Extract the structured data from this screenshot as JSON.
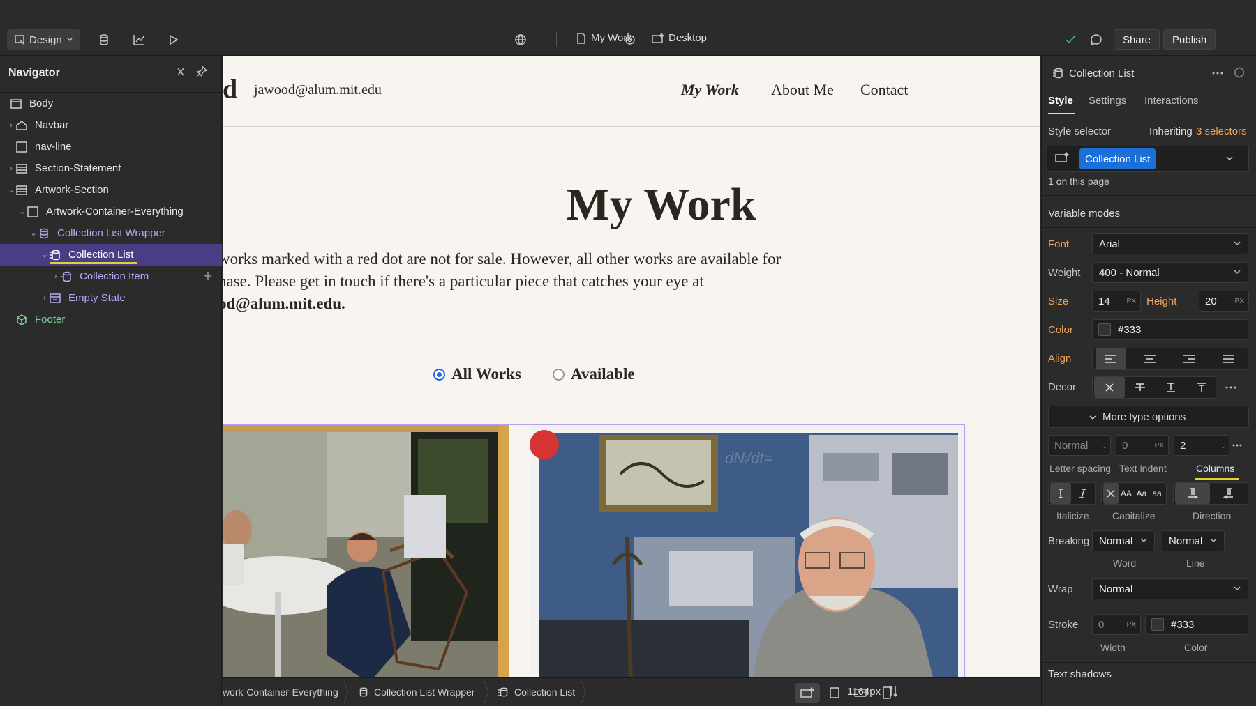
{
  "topbar": {
    "design_label": "Design",
    "page_name": "My Work",
    "breakpoint_label": "Desktop",
    "share_label": "Share",
    "publish_label": "Publish"
  },
  "navigator": {
    "title": "Navigator",
    "items": [
      {
        "label": "Body"
      },
      {
        "label": "Navbar"
      },
      {
        "label": "nav-line"
      },
      {
        "label": "Section-Statement"
      },
      {
        "label": "Artwork-Section"
      },
      {
        "label": "Artwork-Container-Everything"
      },
      {
        "label": "Collection List Wrapper"
      },
      {
        "label": "Collection List"
      },
      {
        "label": "Collection Item"
      },
      {
        "label": "Empty State"
      },
      {
        "label": "Footer"
      }
    ]
  },
  "site": {
    "logo_fragment": "d",
    "email": "jawood@alum.mit.edu",
    "nav": [
      "My Work",
      "About Me",
      "Contact"
    ],
    "title": "My Work",
    "para_line1": "works marked with a red dot are not for sale. However, all other works are available for",
    "para_line2": "hase. Please get in touch if there's a particular piece that catches your eye at",
    "para_line3": "od@alum.mit.edu.",
    "filter_all": "All Works",
    "filter_available": "Available"
  },
  "bottombar": {
    "crumbs": [
      "work-Container-Everything",
      "Collection List Wrapper",
      "Collection List"
    ],
    "width_label": "1164px"
  },
  "panel": {
    "element_title": "Collection List",
    "tabs": [
      "Style",
      "Settings",
      "Interactions"
    ],
    "style_selector_label": "Style selector",
    "inheriting_label": "Inheriting",
    "inheriting_count": "3 selectors",
    "selector_chip": "Collection List",
    "on_page": "1 on this page",
    "variable_modes": "Variable modes",
    "font_label": "Font",
    "font_value": "Arial",
    "weight_label": "Weight",
    "weight_value": "400 - Normal",
    "size_label": "Size",
    "size_value": "14",
    "size_unit": "PX",
    "height_label": "Height",
    "height_value": "20",
    "height_unit": "PX",
    "color_label": "Color",
    "color_value": "#333",
    "align_label": "Align",
    "decor_label": "Decor",
    "more_type": "More type options",
    "letter_spacing_value": "Normal",
    "letter_spacing_unit": "-",
    "text_indent_value": "0",
    "text_indent_unit": "PX",
    "columns_value": "2",
    "columns_unit": "-",
    "letter_spacing_label": "Letter spacing",
    "text_indent_label": "Text indent",
    "columns_label": "Columns",
    "italicize_label": "Italicize",
    "capitalize_label": "Capitalize",
    "direction_label": "Direction",
    "cap_aa1": "AA",
    "cap_aa2": "Aa",
    "cap_aa3": "aa",
    "breaking_label": "Breaking",
    "word_value": "Normal",
    "line_value": "Normal",
    "word_label": "Word",
    "line_label": "Line",
    "wrap_label": "Wrap",
    "wrap_value": "Normal",
    "stroke_label": "Stroke",
    "stroke_width": "0",
    "stroke_unit": "PX",
    "stroke_color": "#333",
    "width_label": "Width",
    "stroke_color_label": "Color",
    "text_shadows": "Text shadows"
  },
  "colors": {
    "accent_orange": "#f0a35b",
    "selection_purple": "#4a3d86",
    "chip_blue": "#1a6fd8",
    "red_dot": "#d63434"
  }
}
